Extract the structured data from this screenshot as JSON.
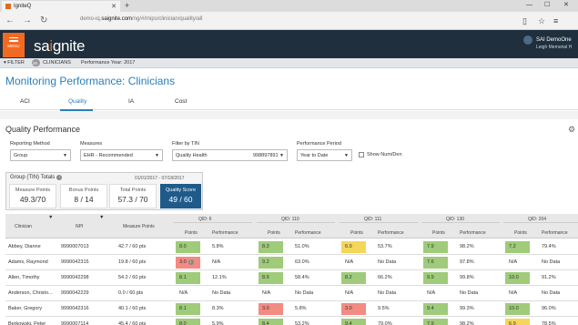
{
  "browser": {
    "tab_title": "IgniteQ",
    "url_prefix": "demo-iq.",
    "url_domain": "saignite.com",
    "url_path": "/ng/#/mips/clinician/quality/all"
  },
  "app": {
    "menu_label": "MENU",
    "logo_prefix": "sa",
    "logo_accent": "i",
    "logo_suffix": "gnite",
    "user_name": "SAI DemoOne",
    "user_org": "Leigh Memorial H"
  },
  "filterbar": {
    "filter_label": "FILTER",
    "badge": "26",
    "scope": "CLINICIANS",
    "period": "Performance Year: 2017"
  },
  "page_title": "Monitoring Performance: Clinicians",
  "tabs": [
    {
      "label": "ACI"
    },
    {
      "label": "Quality"
    },
    {
      "label": "IA"
    },
    {
      "label": "Cost"
    }
  ],
  "section_title": "Quality Performance",
  "filters": {
    "reporting_method": {
      "label": "Reporting Method",
      "value": "Group"
    },
    "measures": {
      "label": "Measures",
      "value": "EHR - Recommended"
    },
    "tin": {
      "label": "Filter by TIN",
      "value": "Quality Health",
      "number": "998897891"
    },
    "period": {
      "label": "Performance Period",
      "value": "Year to Date"
    },
    "show_num_den": "Show Num/Den"
  },
  "totals": {
    "title": "Group (TIN) Totals",
    "dates": "01/01/2017 - 07/18/2017",
    "boxes": [
      {
        "label": "Measure Points",
        "value": "49.3/70"
      },
      {
        "label": "Bonus Points",
        "value": "8 / 14"
      },
      {
        "label": "Total Points",
        "value": "57.3 / 70"
      },
      {
        "label": "Quality Score",
        "value": "49 / 60"
      }
    ]
  },
  "table": {
    "col_clinician": "Clinician",
    "col_npi": "NPI",
    "col_measure_points": "Measure Points",
    "qids": [
      "QID: 6",
      "QID: 110",
      "QID: 111",
      "QID: 130",
      "QID: 204"
    ],
    "sub_points": "Points",
    "sub_performance": "Performance",
    "rows": [
      {
        "name": "Abbey, Dianne",
        "npi": "9990007013",
        "mp": "42.7 / 60 pts",
        "cells": [
          [
            "8.0",
            "5.8%"
          ],
          [
            "8.3",
            "51.0%"
          ],
          [
            "6.9",
            "53.7%"
          ],
          [
            "7.9",
            "98.2%"
          ],
          [
            "7.2",
            "79.4%"
          ]
        ],
        "colors": [
          "green",
          "green",
          "yellow",
          "green",
          "green"
        ]
      },
      {
        "name": "Adams, Raymond",
        "npi": "9990042315",
        "mp": "19.8 / 60 pts",
        "cells": [
          [
            "3.0",
            "N/A"
          ],
          [
            "9.2",
            "63.0%"
          ],
          [
            "N/A",
            "No Data"
          ],
          [
            "7.6",
            "97.8%"
          ],
          [
            "N/A",
            "No Data"
          ]
        ],
        "colors": [
          "red",
          "green",
          "",
          "green",
          ""
        ]
      },
      {
        "name": "Allen, Timothy",
        "npi": "9990042298",
        "mp": "54.2 / 60 pts",
        "cells": [
          [
            "8.1",
            "12.1%"
          ],
          [
            "8.9",
            "58.4%"
          ],
          [
            "8.2",
            "66.2%"
          ],
          [
            "9.9",
            "99.8%"
          ],
          [
            "10.0",
            "91.2%"
          ]
        ],
        "colors": [
          "green",
          "green",
          "green",
          "green",
          "green"
        ]
      },
      {
        "name": "Anderson, Christo...",
        "npi": "9990042229",
        "mp": "0.0 / 60 pts",
        "cells": [
          [
            "N/A",
            "No Data"
          ],
          [
            "N/A",
            "No Data"
          ],
          [
            "N/A",
            "No Data"
          ],
          [
            "N/A",
            "No Data"
          ],
          [
            "N/A",
            "No Data"
          ]
        ],
        "colors": [
          "",
          "",
          "",
          "",
          ""
        ]
      },
      {
        "name": "Baker, Gregory",
        "npi": "9990042316",
        "mp": "40.1 / 60 pts",
        "cells": [
          [
            "8.1",
            "8.3%"
          ],
          [
            "3.0",
            "5.8%"
          ],
          [
            "3.0",
            "9.5%"
          ],
          [
            "9.4",
            "99.3%"
          ],
          [
            "10.0",
            "96.0%"
          ]
        ],
        "colors": [
          "green",
          "red",
          "red",
          "green",
          "green"
        ]
      },
      {
        "name": "Berkowski, Peter",
        "npi": "9990007114",
        "mp": "45.4 / 60 pts",
        "cells": [
          [
            "8.0",
            "5.9%"
          ],
          [
            "8.4",
            "53.2%"
          ],
          [
            "9.4",
            "79.0%"
          ],
          [
            "7.9",
            "98.2%"
          ],
          [
            "6.9",
            "78.5%"
          ]
        ],
        "colors": [
          "green",
          "green",
          "green",
          "green",
          "yellow"
        ]
      }
    ]
  }
}
